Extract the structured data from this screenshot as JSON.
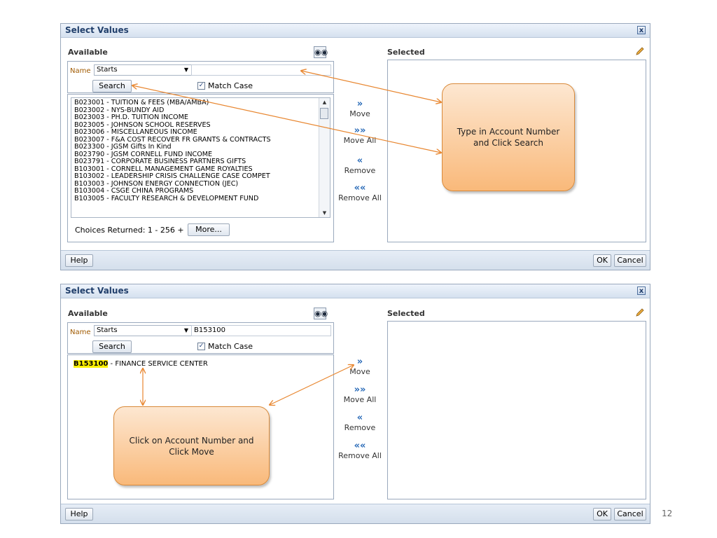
{
  "dialog1": {
    "title": "Select Values",
    "close_glyph": "x",
    "available_label": "Available",
    "selected_label": "Selected",
    "name_label": "Name",
    "operator": "Starts",
    "name_value": "",
    "search_label": "Search",
    "match_case_label": "Match Case",
    "match_case_checked": true,
    "list_items": [
      "B023001 - TUITION & FEES (MBA/AMBA)",
      "B023002 - NYS-BUNDY AID",
      "B023003 - PH.D. TUITION INCOME",
      "B023005 - JOHNSON SCHOOL RESERVES",
      "B023006 - MISCELLANEOUS INCOME",
      "B023007 - F&A COST RECOVER FR GRANTS & CONTRACTS",
      "B023300 - JGSM Gifts In Kind",
      "B023790 - JGSM CORNELL FUND INCOME",
      "B023791 - CORPORATE BUSINESS PARTNERS GIFTS",
      "B103001 - CORNELL MANAGEMENT GAME ROYALTIES",
      "B103002 - LEADERSHIP CRISIS CHALLENGE CASE COMPET",
      "B103003 - JOHNSON ENERGY CONNECTION (JEC)",
      "B103004 - CSGE CHINA PROGRAMS",
      "B103005 - FACULTY RESEARCH & DEVELOPMENT FUND"
    ],
    "choices_text": "Choices Returned: 1 - 256 +",
    "more_label": "More...",
    "move_label": "Move",
    "move_all_label": "Move All",
    "remove_label": "Remove",
    "remove_all_label": "Remove All",
    "help_label": "Help",
    "ok_label": "OK",
    "cancel_label": "Cancel",
    "callout": "Type in Account Number and Click Search"
  },
  "dialog2": {
    "title": "Select Values",
    "close_glyph": "x",
    "available_label": "Available",
    "selected_label": "Selected",
    "name_label": "Name",
    "operator": "Starts",
    "name_value": "B153100",
    "search_label": "Search",
    "match_case_label": "Match Case",
    "match_case_checked": true,
    "result_code": "B153100",
    "result_desc": " - FINANCE SERVICE CENTER",
    "move_label": "Move",
    "move_all_label": "Move All",
    "remove_label": "Remove",
    "remove_all_label": "Remove All",
    "help_label": "Help",
    "ok_label": "OK",
    "cancel_label": "Cancel",
    "callout": "Click on Account Number and Click Move"
  },
  "icons": {
    "search_binoculars": "binoculars-icon",
    "edit": "pencil-icon",
    "move": "»",
    "move_all": "»»",
    "remove": "«",
    "remove_all": "««"
  },
  "colors": {
    "callout_fill": "#f9b97a",
    "callout_border": "#d98a3a",
    "arrow": "#e8862f",
    "highlight": "#fff200",
    "titlebar": "#d5e1ef"
  },
  "page_number": "12"
}
